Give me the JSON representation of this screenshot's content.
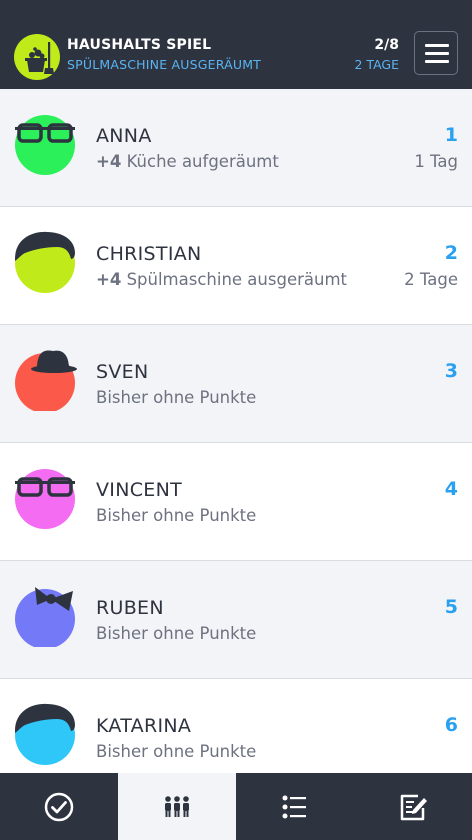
{
  "header": {
    "title": "HAUSHALTS SPIEL",
    "subtitle": "SPÜLMASCHINE AUSGERÄUMT",
    "progress": "2/8",
    "days": "2 TAGE",
    "logo_icon": "cleaning-bucket-icon",
    "menu_icon": "hamburger-menu-icon"
  },
  "players": [
    {
      "name": "ANNA",
      "points": "+4",
      "activity": "Küche aufgeräumt",
      "rank": "1",
      "time_ago": "1 Tag",
      "avatar_color": "#2cf05a",
      "avatar_icon": "glasses-avatar-icon"
    },
    {
      "name": "CHRISTIAN",
      "points": "+4",
      "activity": "Spülmaschine ausgeräumt",
      "rank": "2",
      "time_ago": "2 Tage",
      "avatar_color": "#c1ea1b",
      "avatar_icon": "hair-avatar-icon"
    },
    {
      "name": "SVEN",
      "status": "Bisher ohne Punkte",
      "rank": "3",
      "avatar_color": "#fb5a4a",
      "avatar_icon": "hat-avatar-icon"
    },
    {
      "name": "VINCENT",
      "status": "Bisher ohne Punkte",
      "rank": "4",
      "avatar_color": "#f36cf2",
      "avatar_icon": "glasses-avatar-icon"
    },
    {
      "name": "RUBEN",
      "status": "Bisher ohne Punkte",
      "rank": "5",
      "avatar_color": "#7479f7",
      "avatar_icon": "bow-avatar-icon"
    },
    {
      "name": "KATARINA",
      "status": "Bisher ohne Punkte",
      "rank": "6",
      "avatar_color": "#2fc7f7",
      "avatar_icon": "hair-avatar-icon"
    }
  ],
  "tabs": [
    {
      "icon": "checkmark-circle-icon",
      "active": false
    },
    {
      "icon": "people-icon",
      "active": true
    },
    {
      "icon": "list-icon",
      "active": false
    },
    {
      "icon": "edit-note-icon",
      "active": false
    }
  ],
  "colors": {
    "header_bg": "#2e3340",
    "accent_blue": "#29a0f0",
    "subtitle_blue": "#5ab4f2",
    "row_alt_bg": "#f3f4f7"
  }
}
